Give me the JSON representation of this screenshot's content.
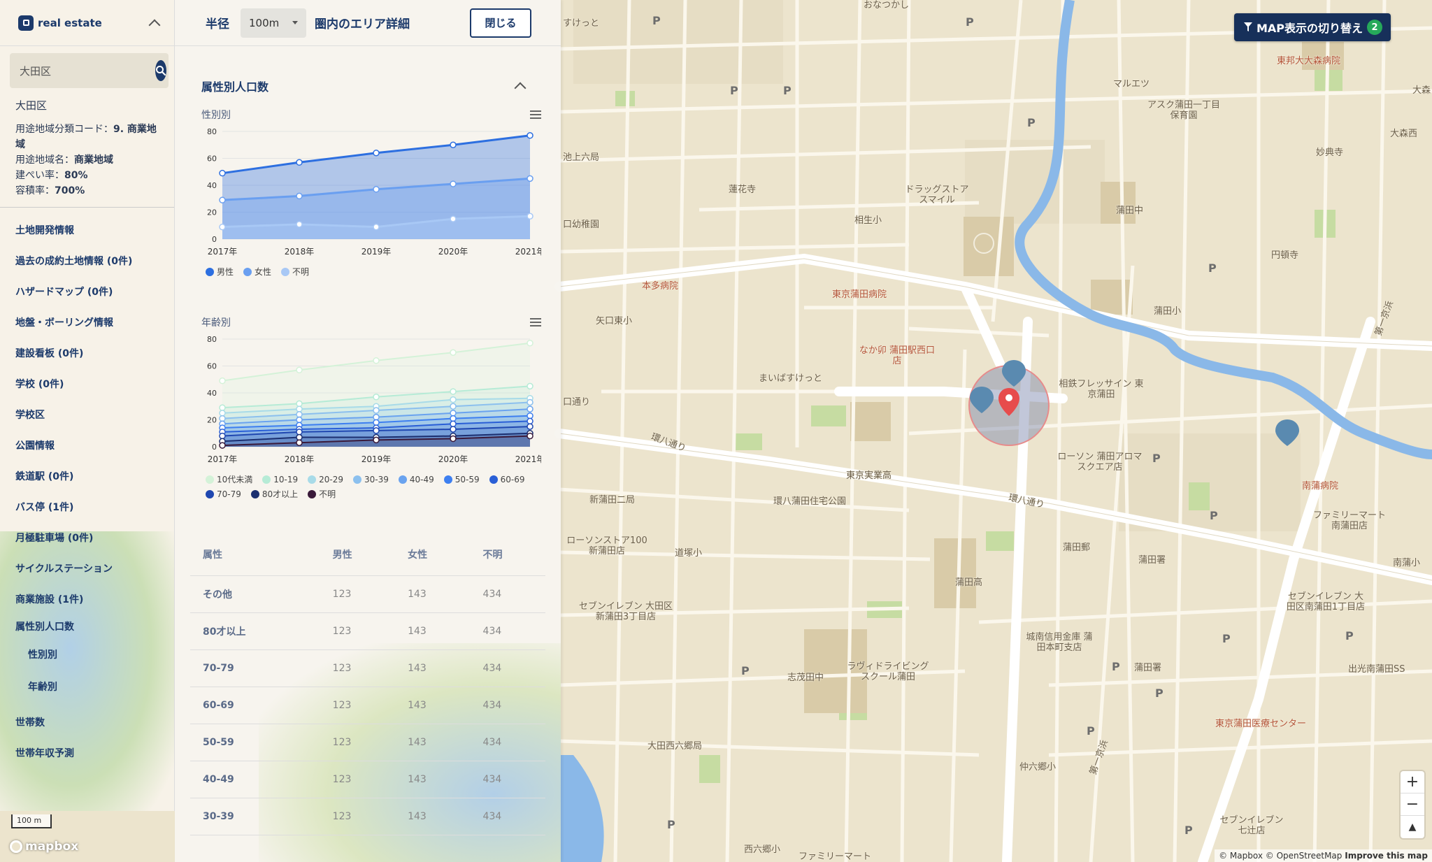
{
  "app": {
    "title": "real estate"
  },
  "search": {
    "value": "大田区",
    "placeholder": "大田区"
  },
  "info": {
    "area_name": "大田区",
    "lines": [
      {
        "label": "用途地域分類コード：",
        "value": "9. 商業地域"
      },
      {
        "label": "用途地域名：",
        "value": "商業地域"
      },
      {
        "label": "建ぺい率：",
        "value": "80%"
      },
      {
        "label": "容積率：",
        "value": "700%"
      }
    ]
  },
  "nav": {
    "items": [
      "土地開発情報",
      "過去の成約土地情報 (0件)",
      "ハザードマップ (0件)",
      "地盤・ボーリング情報",
      "建設看板 (0件)",
      "学校 (0件)",
      "学校区",
      "公園情報",
      "鉄道駅 (0件)",
      "バス停 (1件)",
      "月極駐車場 (0件)",
      "サイクルステーション",
      "商業施設 (1件)"
    ],
    "parent": "属性別人口数",
    "subs": [
      "性別別",
      "年齢別"
    ],
    "tail": [
      "世帯数",
      "世帯年収予測"
    ]
  },
  "panel": {
    "radius_label": "半径",
    "radius_value": "100m",
    "title_suffix": "圏内のエリア詳細",
    "close_label": "閉じる",
    "section_title": "属性別人口数"
  },
  "chart_data": [
    {
      "type": "area",
      "title": "性別別",
      "categories": [
        "2017年",
        "2018年",
        "2019年",
        "2020年",
        "2021年"
      ],
      "ylim": [
        0,
        80
      ],
      "yticks": [
        0,
        20,
        40,
        60,
        80
      ],
      "legend_position": "bottom",
      "series": [
        {
          "name": "男性",
          "color": "#2d6fe0",
          "values": [
            49,
            57,
            64,
            70,
            77
          ]
        },
        {
          "name": "女性",
          "color": "#6a9ff0",
          "values": [
            29,
            32,
            37,
            41,
            45
          ]
        },
        {
          "name": "不明",
          "color": "#a8c8f5",
          "values": [
            9,
            11,
            9,
            15,
            17
          ]
        }
      ]
    },
    {
      "type": "line",
      "title": "年齢別",
      "categories": [
        "2017年",
        "2018年",
        "2019年",
        "2020年",
        "2021年"
      ],
      "ylim": [
        0,
        80
      ],
      "yticks": [
        0,
        20,
        40,
        60,
        80
      ],
      "legend_position": "bottom",
      "series": [
        {
          "name": "10代未満",
          "color": "#d4f2d8",
          "values": [
            49,
            57,
            64,
            70,
            77
          ]
        },
        {
          "name": "10-19",
          "color": "#b6ebd6",
          "values": [
            29,
            32,
            37,
            41,
            45
          ]
        },
        {
          "name": "20-29",
          "color": "#a8dbe8",
          "values": [
            25,
            28,
            30,
            35,
            36
          ]
        },
        {
          "name": "30-39",
          "color": "#8cc0ee",
          "values": [
            21,
            24,
            27,
            30,
            33
          ]
        },
        {
          "name": "40-49",
          "color": "#6aa3ef",
          "values": [
            17,
            20,
            22,
            25,
            28
          ]
        },
        {
          "name": "50-59",
          "color": "#3d7ff0",
          "values": [
            14,
            16,
            18,
            21,
            23
          ]
        },
        {
          "name": "60-69",
          "color": "#2a5fd6",
          "values": [
            11,
            13,
            14,
            17,
            19
          ]
        },
        {
          "name": "70-79",
          "color": "#1f47b0",
          "values": [
            8,
            11,
            12,
            13,
            15
          ]
        },
        {
          "name": "80才以上",
          "color": "#1b2f70",
          "values": [
            4,
            7,
            7,
            8,
            10
          ]
        },
        {
          "name": "不明",
          "color": "#3a1a3a",
          "values": [
            1,
            3,
            5,
            6,
            8
          ]
        }
      ]
    }
  ],
  "table": {
    "headers": [
      "属性",
      "男性",
      "女性",
      "不明"
    ],
    "rows": [
      [
        "その他",
        "123",
        "143",
        "434"
      ],
      [
        "80才以上",
        "123",
        "143",
        "434"
      ],
      [
        "70-79",
        "123",
        "143",
        "434"
      ],
      [
        "60-69",
        "123",
        "143",
        "434"
      ],
      [
        "50-59",
        "123",
        "143",
        "434"
      ],
      [
        "40-49",
        "123",
        "143",
        "434"
      ],
      [
        "30-39",
        "123",
        "143",
        "434"
      ]
    ]
  },
  "map": {
    "toggle_label": "MAP表示の切り替え",
    "toggle_badge": "2",
    "scale": "100 m",
    "attribution": "© Mapbox © OpenStreetMap",
    "improve": "Improve this map",
    "logo": "mapbox",
    "labels": [
      "すけっと",
      "おなつかし",
      "東邦大大森病院",
      "大森",
      "マルエツ",
      "アスク蒲田一丁目保育園",
      "大森西",
      "妙典寺",
      "池上六局",
      "蓮花寺",
      "ドラッグストア スマイル",
      "相生小",
      "蒲田中",
      "円頓寺",
      "口幼稚園",
      "本多病院",
      "東京蒲田病院",
      "矢口東小",
      "蒲田小",
      "なか卯 蒲田駅西口店",
      "まいばすけっと",
      "相鉄フレッサイン 東京蒲田",
      "ローソン 蒲田アロマスクエア店",
      "東京実業高",
      "南蒲病院",
      "ファミリーマート 南蒲田店",
      "新蒲田二局",
      "環八蒲田住宅公園",
      "環八通り",
      "環八通り",
      "ローソンストア100 新蒲田店",
      "道塚小",
      "蒲田郵",
      "蒲田署",
      "南蒲小",
      "蒲田高",
      "セブンイレブン 大田区南蒲田1丁目店",
      "セブンイレブン 大田区新蒲田3丁目店",
      "城南信用金庫 蒲田本町支店",
      "ラヴィドライビング スクール蒲田",
      "志茂田中",
      "蒲田署",
      "出光南蒲田SS",
      "東京蒲田医療センター",
      "大田西六郷局",
      "仲六郷小",
      "第一京浜",
      "セブンイレブン 七辻店",
      "西六郷小",
      "ファミリーマート",
      "第一京浜",
      "口通り"
    ]
  }
}
